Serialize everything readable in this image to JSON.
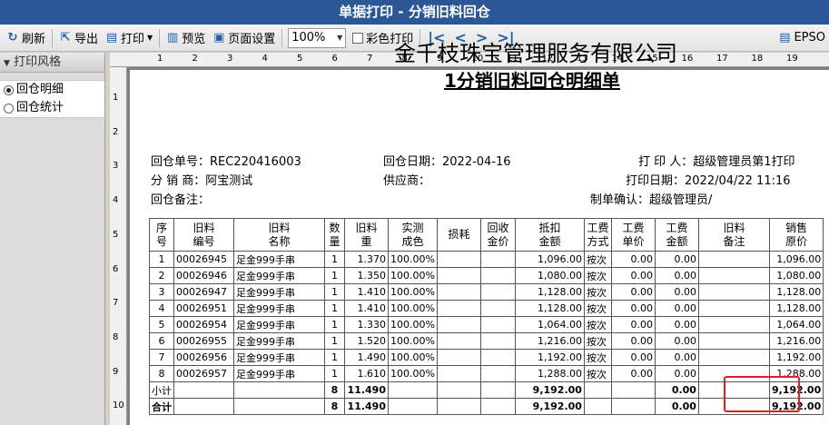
{
  "window": {
    "title": "单据打印 - 分销旧料回仓"
  },
  "toolbar": {
    "refresh": "刷新",
    "export": "导出",
    "print": "打印",
    "preview": "预览",
    "page_setup": "页面设置",
    "zoom": "100%",
    "color_print": "彩色打印",
    "printer": "EPSO"
  },
  "sidebar": {
    "header": "打印风格",
    "items": [
      {
        "label": "回仓明细",
        "selected": true
      },
      {
        "label": "回仓统计",
        "selected": false
      }
    ]
  },
  "ruler": {
    "h": [
      "1",
      "2",
      "3",
      "4",
      "5",
      "6",
      "7",
      "8",
      "9",
      "10",
      "11",
      "12",
      "13",
      "14",
      "15",
      "16",
      "17",
      "18",
      "19"
    ],
    "v": [
      "1",
      "2",
      "3",
      "4",
      "5",
      "6",
      "7",
      "8",
      "9",
      "10"
    ]
  },
  "doc": {
    "company": "金千枝珠宝管理服务有限公司",
    "title": "1分销旧料回仓明细单",
    "order_no": "回仓单号：REC220416003",
    "order_date": "回仓日期：2022-04-16",
    "printer": "打 印 人：超级管理员第1打印",
    "distributor": "分 销 商：阿宝测试",
    "supplier": "供应商：",
    "print_date": "打印日期：2022/04/22 11:16",
    "remark": "回仓备注：",
    "confirm": "制单确认：超级管理员/"
  },
  "table": {
    "headers": [
      "序\n号",
      "旧料\n编号",
      "旧料\n名称",
      "数\n量",
      "旧料\n重",
      "实测\n成色",
      "损耗",
      "回收\n金价",
      "抵扣\n金额",
      "工费\n方式",
      "工费\n单价",
      "工费\n金额",
      "旧料\n备注",
      "销售\n原价"
    ],
    "rows": [
      [
        "1",
        "00026945",
        "足金999手串",
        "1",
        "1.370",
        "100.00%",
        "",
        "",
        "1,096.00",
        "按次",
        "0.00",
        "0.00",
        "",
        "1,096.00"
      ],
      [
        "2",
        "00026946",
        "足金999手串",
        "1",
        "1.350",
        "100.00%",
        "",
        "",
        "1,080.00",
        "按次",
        "0.00",
        "0.00",
        "",
        "1,080.00"
      ],
      [
        "3",
        "00026947",
        "足金999手串",
        "1",
        "1.410",
        "100.00%",
        "",
        "",
        "1,128.00",
        "按次",
        "0.00",
        "0.00",
        "",
        "1,128.00"
      ],
      [
        "4",
        "00026951",
        "足金999手串",
        "1",
        "1.410",
        "100.00%",
        "",
        "",
        "1,128.00",
        "按次",
        "0.00",
        "0.00",
        "",
        "1,128.00"
      ],
      [
        "5",
        "00026954",
        "足金999手串",
        "1",
        "1.330",
        "100.00%",
        "",
        "",
        "1,064.00",
        "按次",
        "0.00",
        "0.00",
        "",
        "1,064.00"
      ],
      [
        "6",
        "00026955",
        "足金999手串",
        "1",
        "1.520",
        "100.00%",
        "",
        "",
        "1,216.00",
        "按次",
        "0.00",
        "0.00",
        "",
        "1,216.00"
      ],
      [
        "7",
        "00026956",
        "足金999手串",
        "1",
        "1.490",
        "100.00%",
        "",
        "",
        "1,192.00",
        "按次",
        "0.00",
        "0.00",
        "",
        "1,192.00"
      ],
      [
        "8",
        "00026957",
        "足金999手串",
        "1",
        "1.610",
        "100.00%",
        "",
        "",
        "1,288.00",
        "按次",
        "0.00",
        "0.00",
        "",
        "1,288.00"
      ]
    ],
    "subtotal": [
      "小计",
      "",
      "",
      "8",
      "11.490",
      "",
      "",
      "",
      "9,192.00",
      "",
      "",
      "0.00",
      "",
      "9,192.00"
    ],
    "total": [
      "合计",
      "",
      "",
      "8",
      "11.490",
      "",
      "",
      "",
      "9,192.00",
      "",
      "",
      "0.00",
      "",
      "9,192.00"
    ]
  },
  "colors": {
    "titlebar": "#2b5797",
    "highlight": "#e02020"
  }
}
